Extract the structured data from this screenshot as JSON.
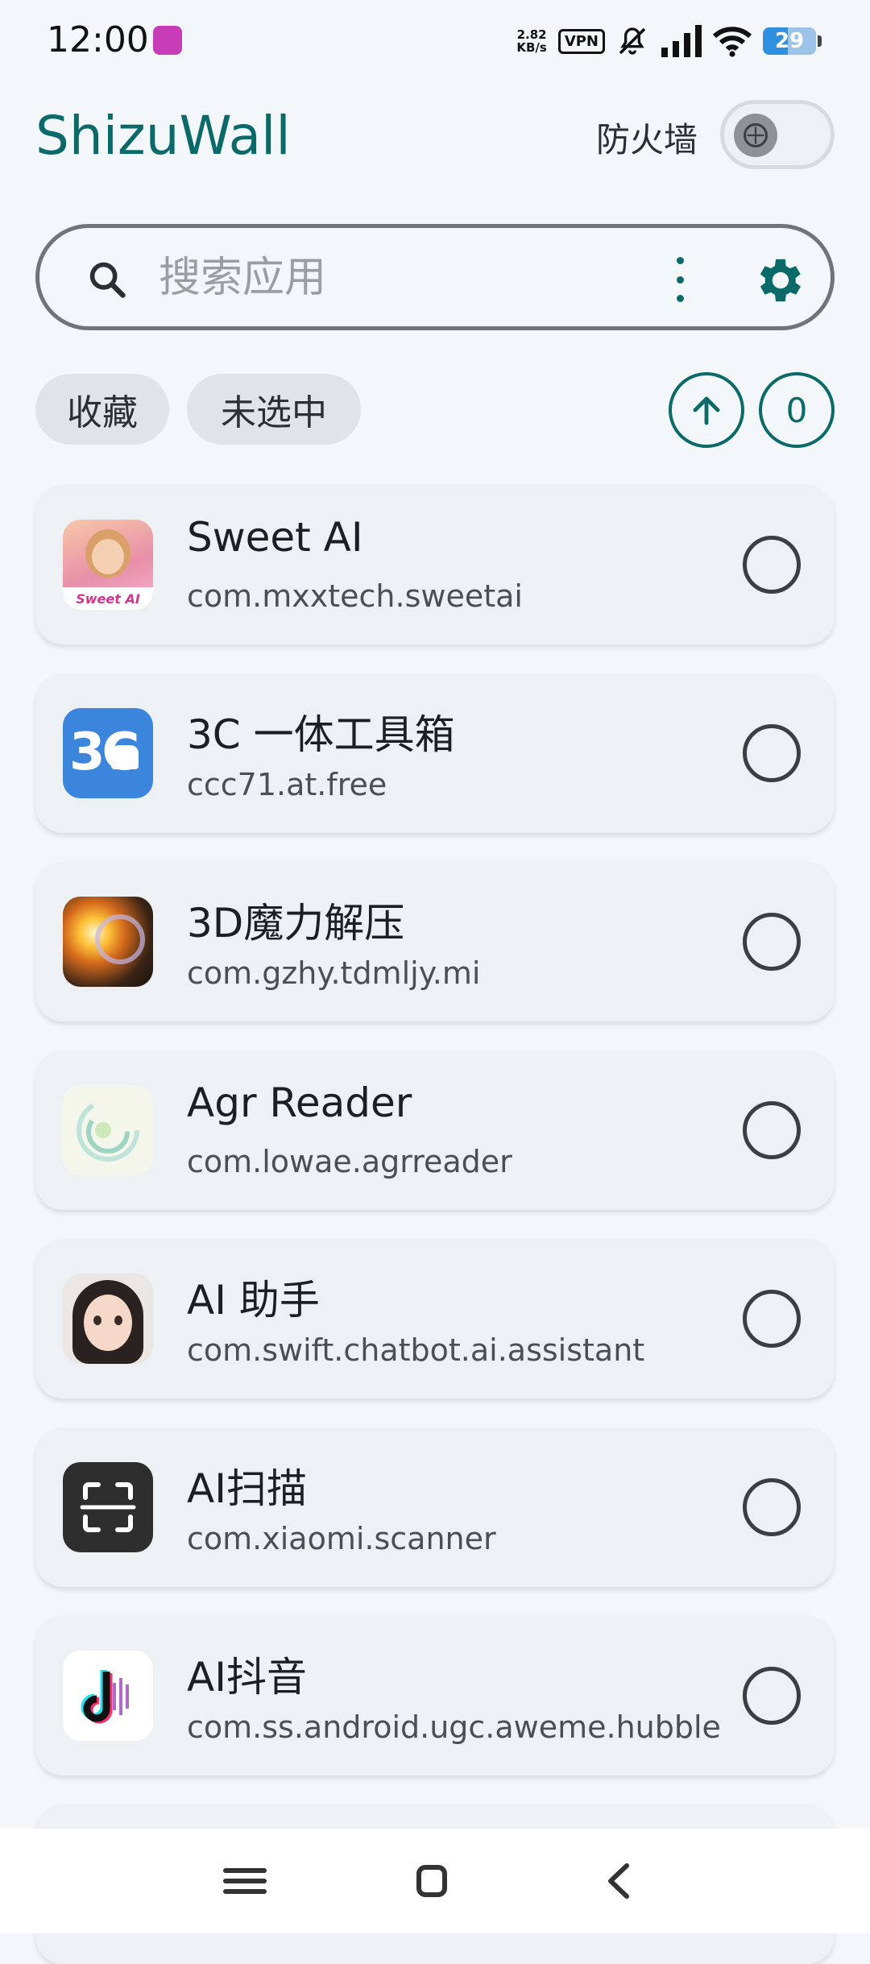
{
  "status_bar": {
    "time": "12:00",
    "net_speed_value": "2.82",
    "net_speed_unit": "KB/s",
    "vpn": "VPN",
    "battery": "29",
    "battery_level_percent": 29
  },
  "app_bar": {
    "title": "ShizuWall",
    "firewall_label": "防火墙",
    "firewall_enabled": false
  },
  "search": {
    "placeholder": "搜索应用",
    "value": ""
  },
  "filters": {
    "favorites": "收藏",
    "unselected": "未选中",
    "selected_count": "0"
  },
  "apps": [
    {
      "name": " Sweet AI",
      "package": "com.mxxtech.sweetai",
      "icon": "sweet-ai-icon",
      "selected": false
    },
    {
      "name": "3C 一体工具箱",
      "package": "ccc71.at.free",
      "icon": "3c-toolbox-icon",
      "selected": false
    },
    {
      "name": "3D魔力解压",
      "package": "com.gzhy.tdmljy.mi",
      "icon": "3d-magic-icon",
      "selected": false
    },
    {
      "name": "Agr Reader",
      "package": "com.lowae.agrreader",
      "icon": "agr-reader-icon",
      "selected": false
    },
    {
      "name": "AI 助手",
      "package": "com.swift.chatbot.ai.assistant",
      "icon": "ai-assistant-icon",
      "selected": false
    },
    {
      "name": "AI扫描",
      "package": "com.xiaomi.scanner",
      "icon": "ai-scanner-icon",
      "selected": false
    },
    {
      "name": "AI抖音",
      "package": "com.ss.android.ugc.aweme.hubble",
      "icon": "ai-douyin-icon",
      "selected": false
    }
  ],
  "colors": {
    "accent": "#0a6a6a",
    "background": "#f3f7fa",
    "card": "#edf1f4"
  }
}
